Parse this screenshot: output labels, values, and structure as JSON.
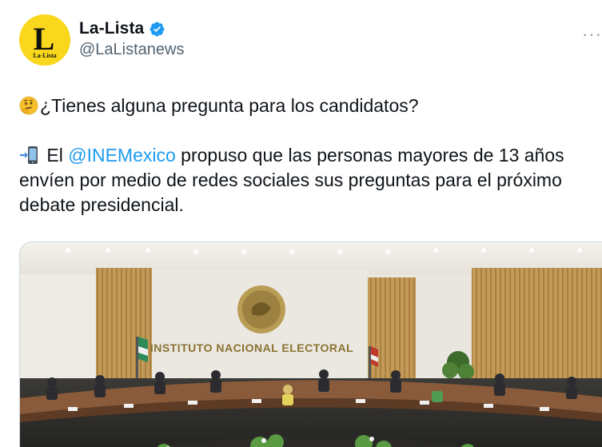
{
  "account": {
    "display_name": "La-Lista",
    "handle": "@LaListanews",
    "avatar_text": "L",
    "avatar_subtext": "La-Lista",
    "verified": true
  },
  "menu": {
    "more_label": "···"
  },
  "tweet": {
    "line1": "¿Tienes alguna pregunta para los candidatos?",
    "line2_prefix": " El ",
    "mention": "@INEMexico",
    "line2_rest": " propuso que las personas mayores de 13 años envíen por medio de redes sociales sus preguntas para el próximo debate presidencial.",
    "emoji1": "thinking-face-icon",
    "emoji2": "mobile-phone-arrow-icon"
  },
  "media": {
    "sign_text": "INSTITUTO NACIONAL ELECTORAL"
  },
  "colors": {
    "accent": "#1d9bf0",
    "text": "#0f1419",
    "secondary": "#536471",
    "avatar_bg": "#f8d71c"
  }
}
